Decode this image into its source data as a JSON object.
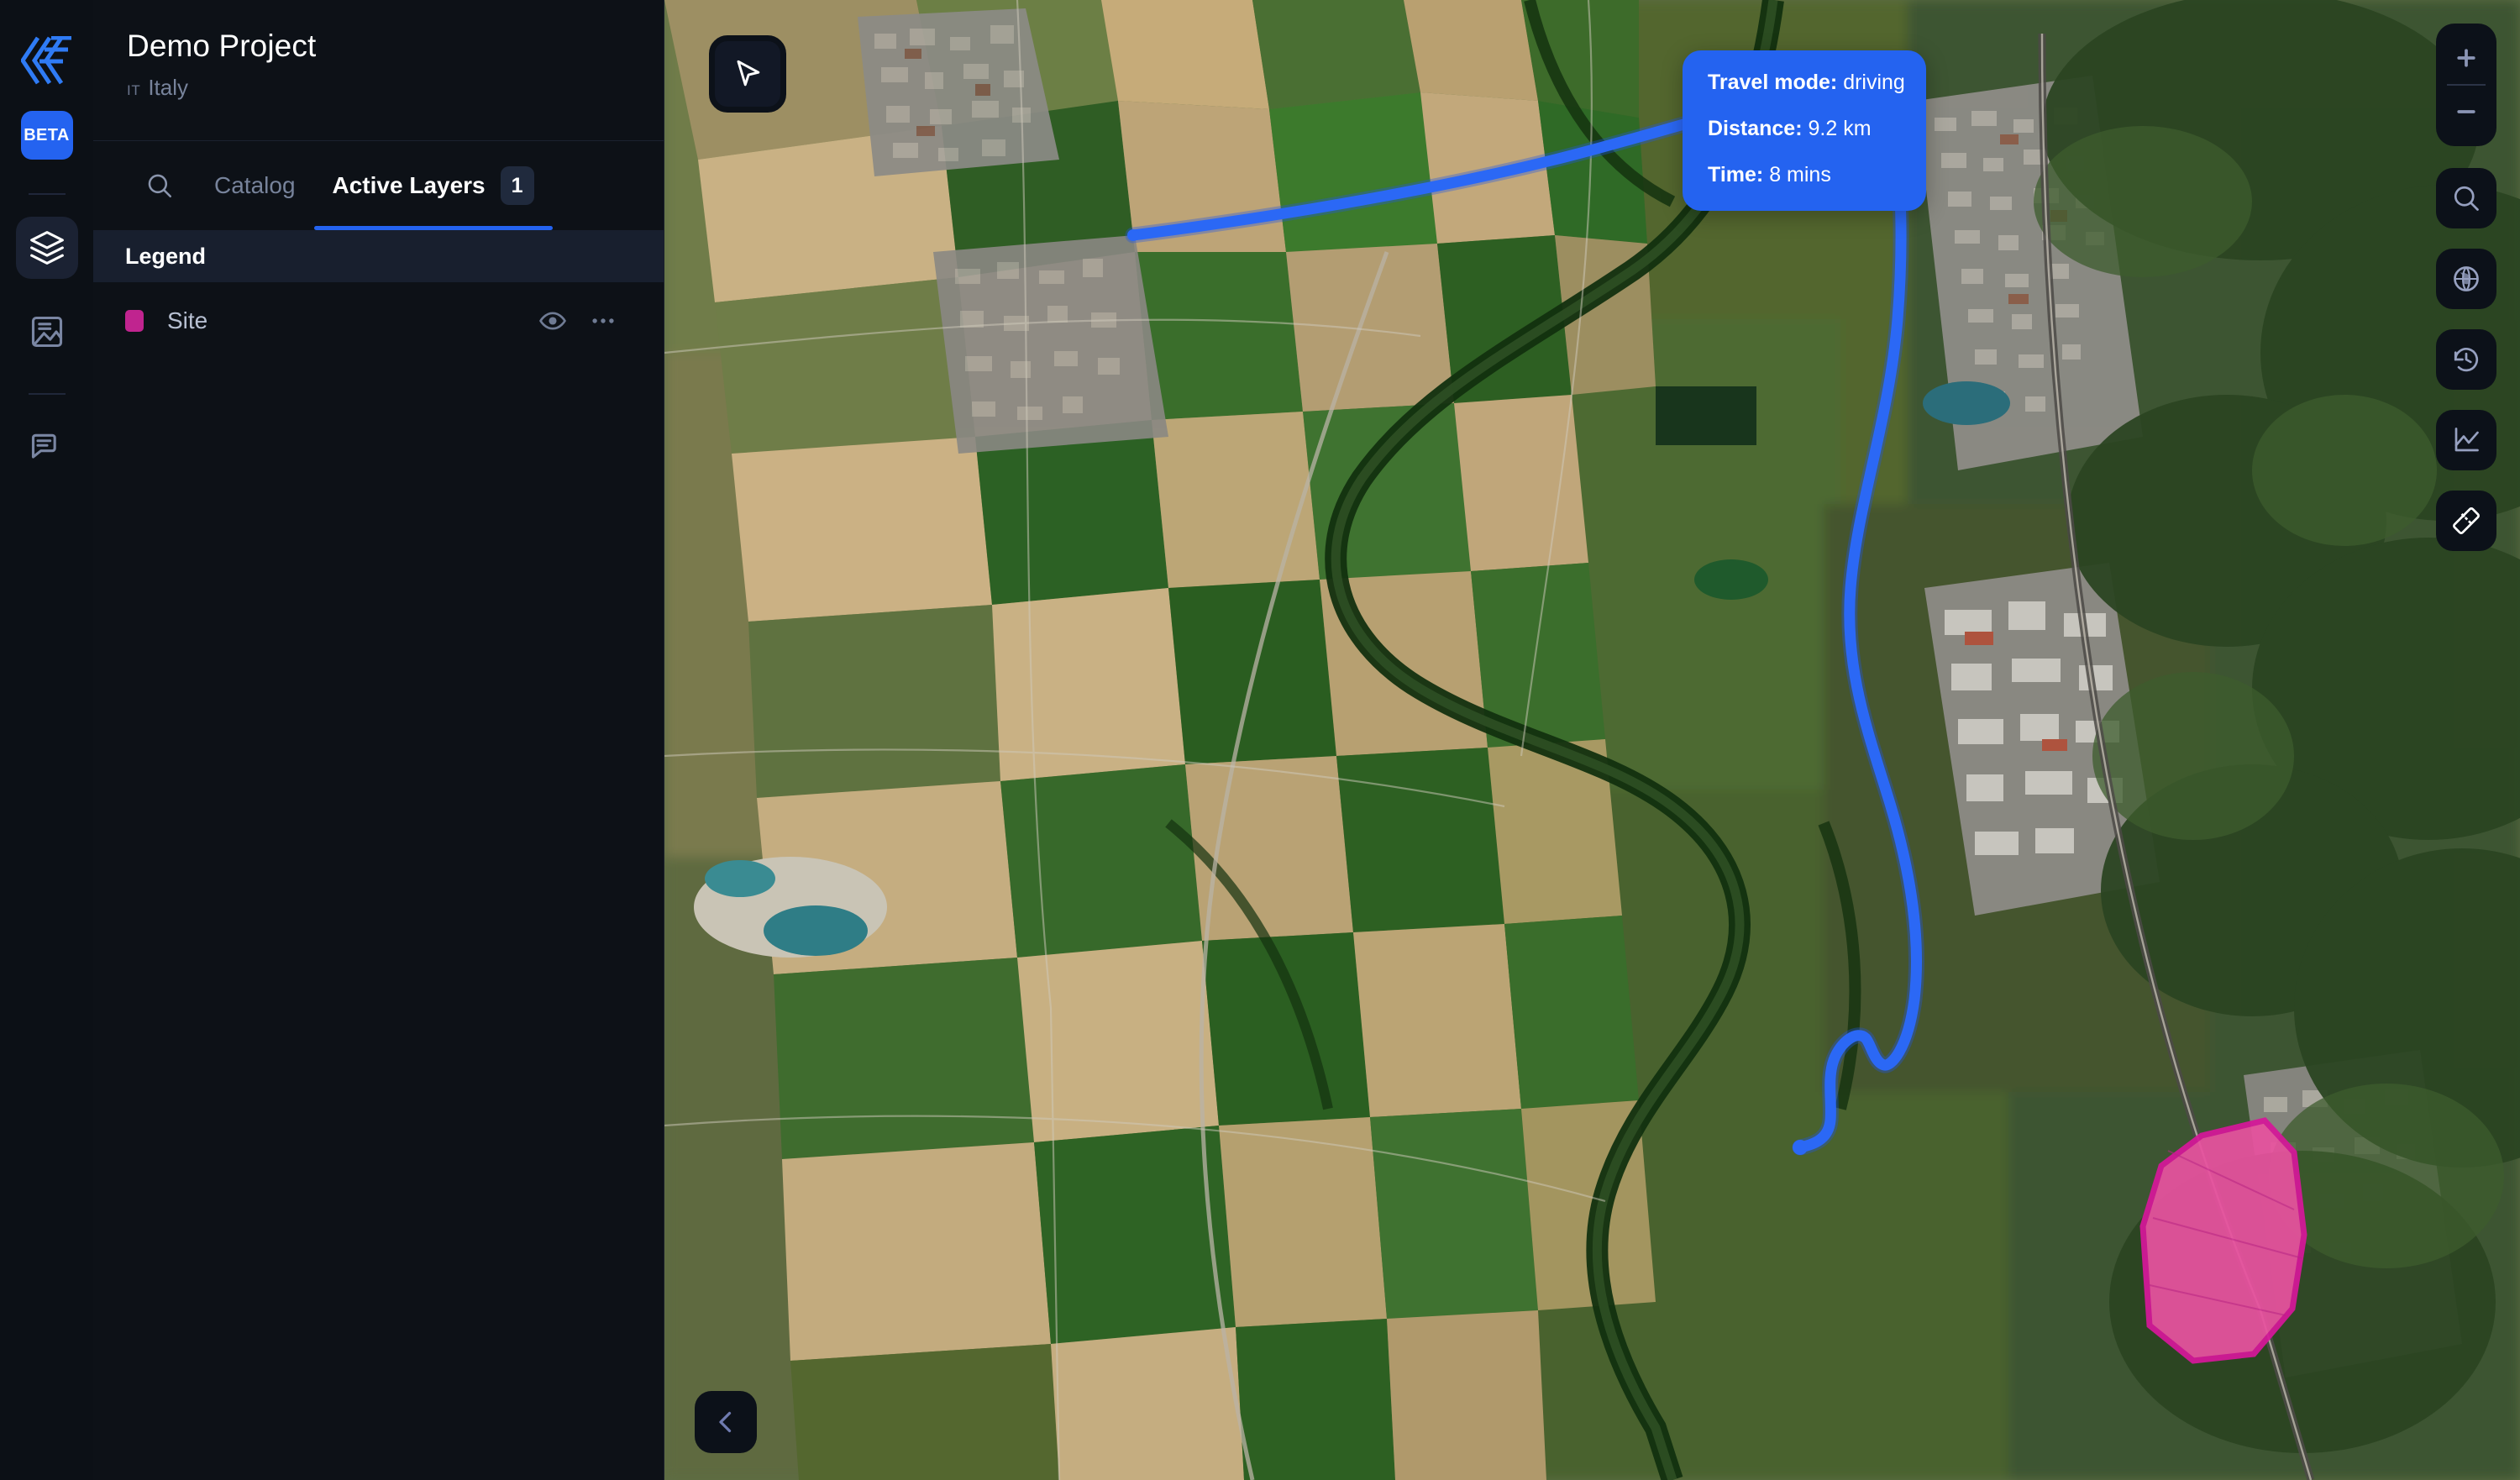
{
  "brand": {
    "logo_icon": "flow-logo-icon",
    "beta_label": "BETA"
  },
  "rail": {
    "items": [
      {
        "icon": "layers-icon",
        "name": "layers",
        "active": true
      },
      {
        "icon": "report-image-icon",
        "name": "reports",
        "active": false
      },
      {
        "icon": "comments-icon",
        "name": "comments",
        "active": false
      }
    ]
  },
  "panel": {
    "project_title": "Demo Project",
    "country_code": "IT",
    "country_name": "Italy",
    "search_icon": "search-icon",
    "tabs": [
      {
        "label": "Catalog",
        "active": false,
        "badge": null
      },
      {
        "label": "Active Layers",
        "active": true,
        "badge": "1"
      }
    ],
    "legend_header": "Legend",
    "layers": [
      {
        "name": "Site",
        "color": "#c0248f",
        "visibility_icon": "eye-icon",
        "menu_icon": "more-options-icon"
      }
    ]
  },
  "map": {
    "cursor_tool_icon": "pointer-cursor-icon",
    "tooltip": {
      "travel_mode_label": "Travel mode:",
      "travel_mode_value": "driving",
      "distance_label": "Distance:",
      "distance_value": "9.2 km",
      "time_label": "Time:",
      "time_value": "8 mins",
      "background": "#2463f0"
    },
    "zoom_controls": {
      "zoom_in": "plus-icon",
      "zoom_out": "minus-icon"
    },
    "right_tools": [
      {
        "icon": "search-icon",
        "name": "search-map",
        "active": false
      },
      {
        "icon": "globe-icon",
        "name": "basemap",
        "active": false
      },
      {
        "icon": "history-icon",
        "name": "time-history",
        "active": false
      },
      {
        "icon": "analytics-chart-icon",
        "name": "analytics",
        "active": false
      },
      {
        "icon": "ruler-measure-icon",
        "name": "measure",
        "active": true
      }
    ],
    "collapse_icon": "chevron-left-icon",
    "route_color": "#2463f0",
    "site_polygon_color": "#e8439c"
  }
}
